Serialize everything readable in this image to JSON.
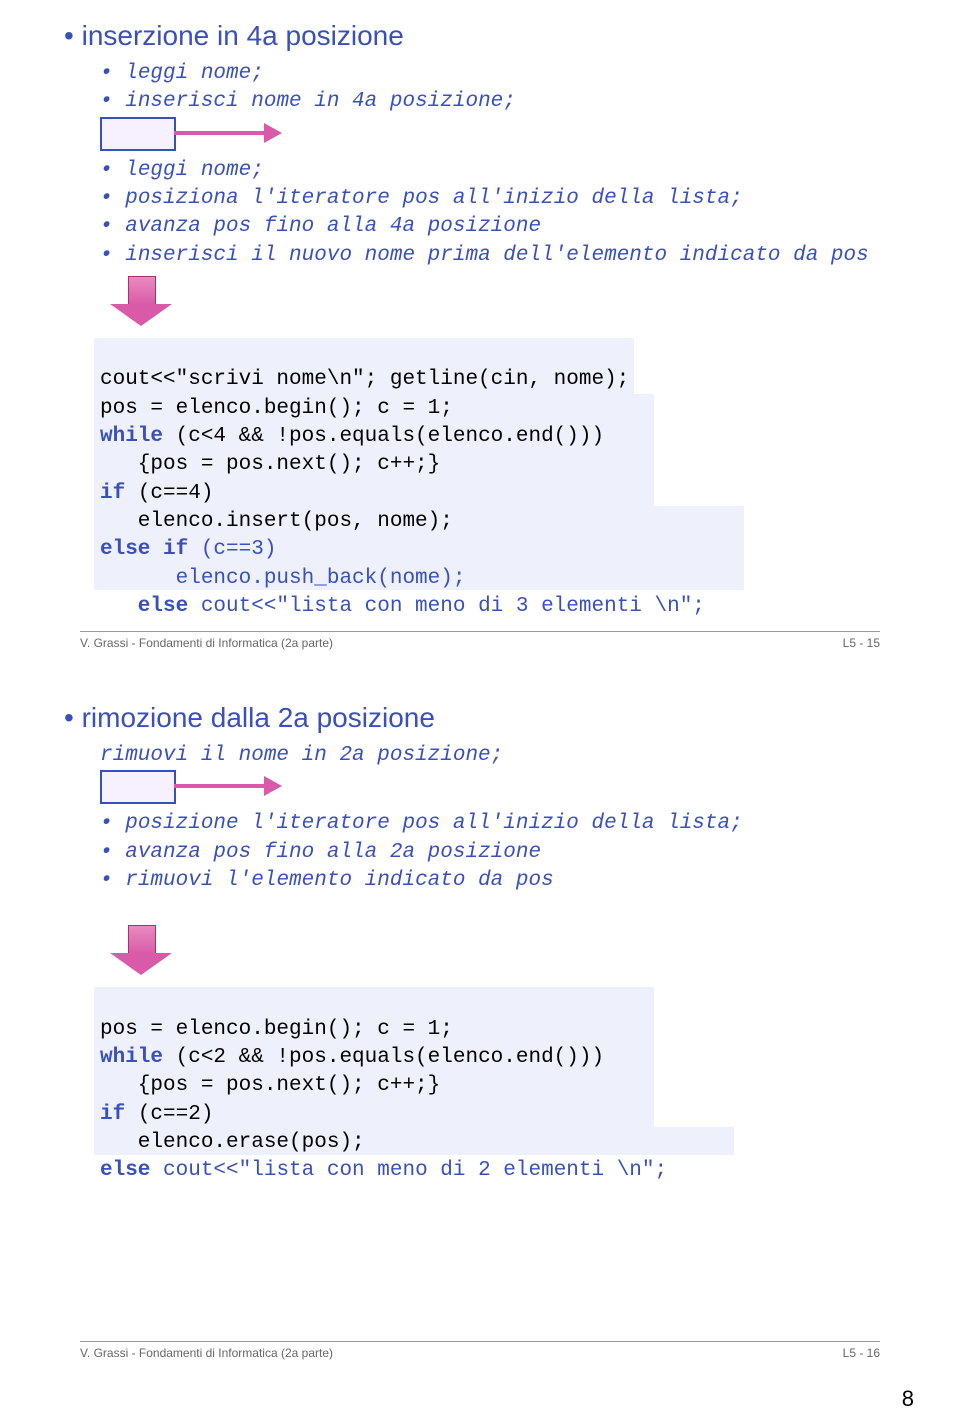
{
  "slide1": {
    "title": "inserzione in 4a posizione",
    "pseudo1": [
      "leggi nome;",
      "inserisci nome in 4a posizione;"
    ],
    "pseudo2": [
      "leggi nome;",
      "posiziona l'iteratore pos all'inizio della lista;",
      "avanza pos fino alla 4a posizione",
      "inserisci il nuovo nome prima dell'elemento indicato da pos"
    ],
    "code": {
      "l1a": "cout<<\"scrivi nome\\n\"; getline(cin, nome);",
      "l2a": "pos = elenco.begin(); c = 1;",
      "l3_head": "while",
      "l3_rest": " (c<4 && !pos.equals(elenco.end()))",
      "l4": "   {pos = pos.next(); c++;}",
      "l5_head": "if",
      "l5_rest": " (c==4)",
      "l6": "   elenco.insert(pos, nome);",
      "l7_head": "else if",
      "l7_rest": " (c==3)",
      "l8": "      elenco.push_back(nome);",
      "l9_head": "   else",
      "l9_rest": " cout<<\"lista con meno di 3 elementi \\n\";"
    },
    "footer_left": "V. Grassi - Fondamenti di Informatica (2a parte)",
    "footer_right": "L5 - 15"
  },
  "slide2": {
    "title": "rimozione dalla 2a posizione",
    "pseudo1": [
      "rimuovi il nome in 2a posizione;"
    ],
    "pseudo2": [
      "posizione l'iteratore pos all'inizio della lista;",
      "avanza pos fino alla 2a posizione",
      "rimuovi l'elemento indicato da pos"
    ],
    "code": {
      "l1a": "pos = elenco.begin(); c = 1;",
      "l2_head": "while",
      "l2_rest": " (c<2 && !pos.equals(elenco.end()))",
      "l3": "   {pos = pos.next(); c++;}",
      "l4_head": "if",
      "l4_rest": " (c==2)",
      "l5": "   elenco.erase(pos);",
      "l6_head": "else",
      "l6_rest": " cout<<\"lista con meno di 2 elementi \\n\";"
    },
    "footer_left": "V. Grassi - Fondamenti di Informatica (2a parte)",
    "footer_right": "L5 - 16"
  },
  "page_number": "8"
}
